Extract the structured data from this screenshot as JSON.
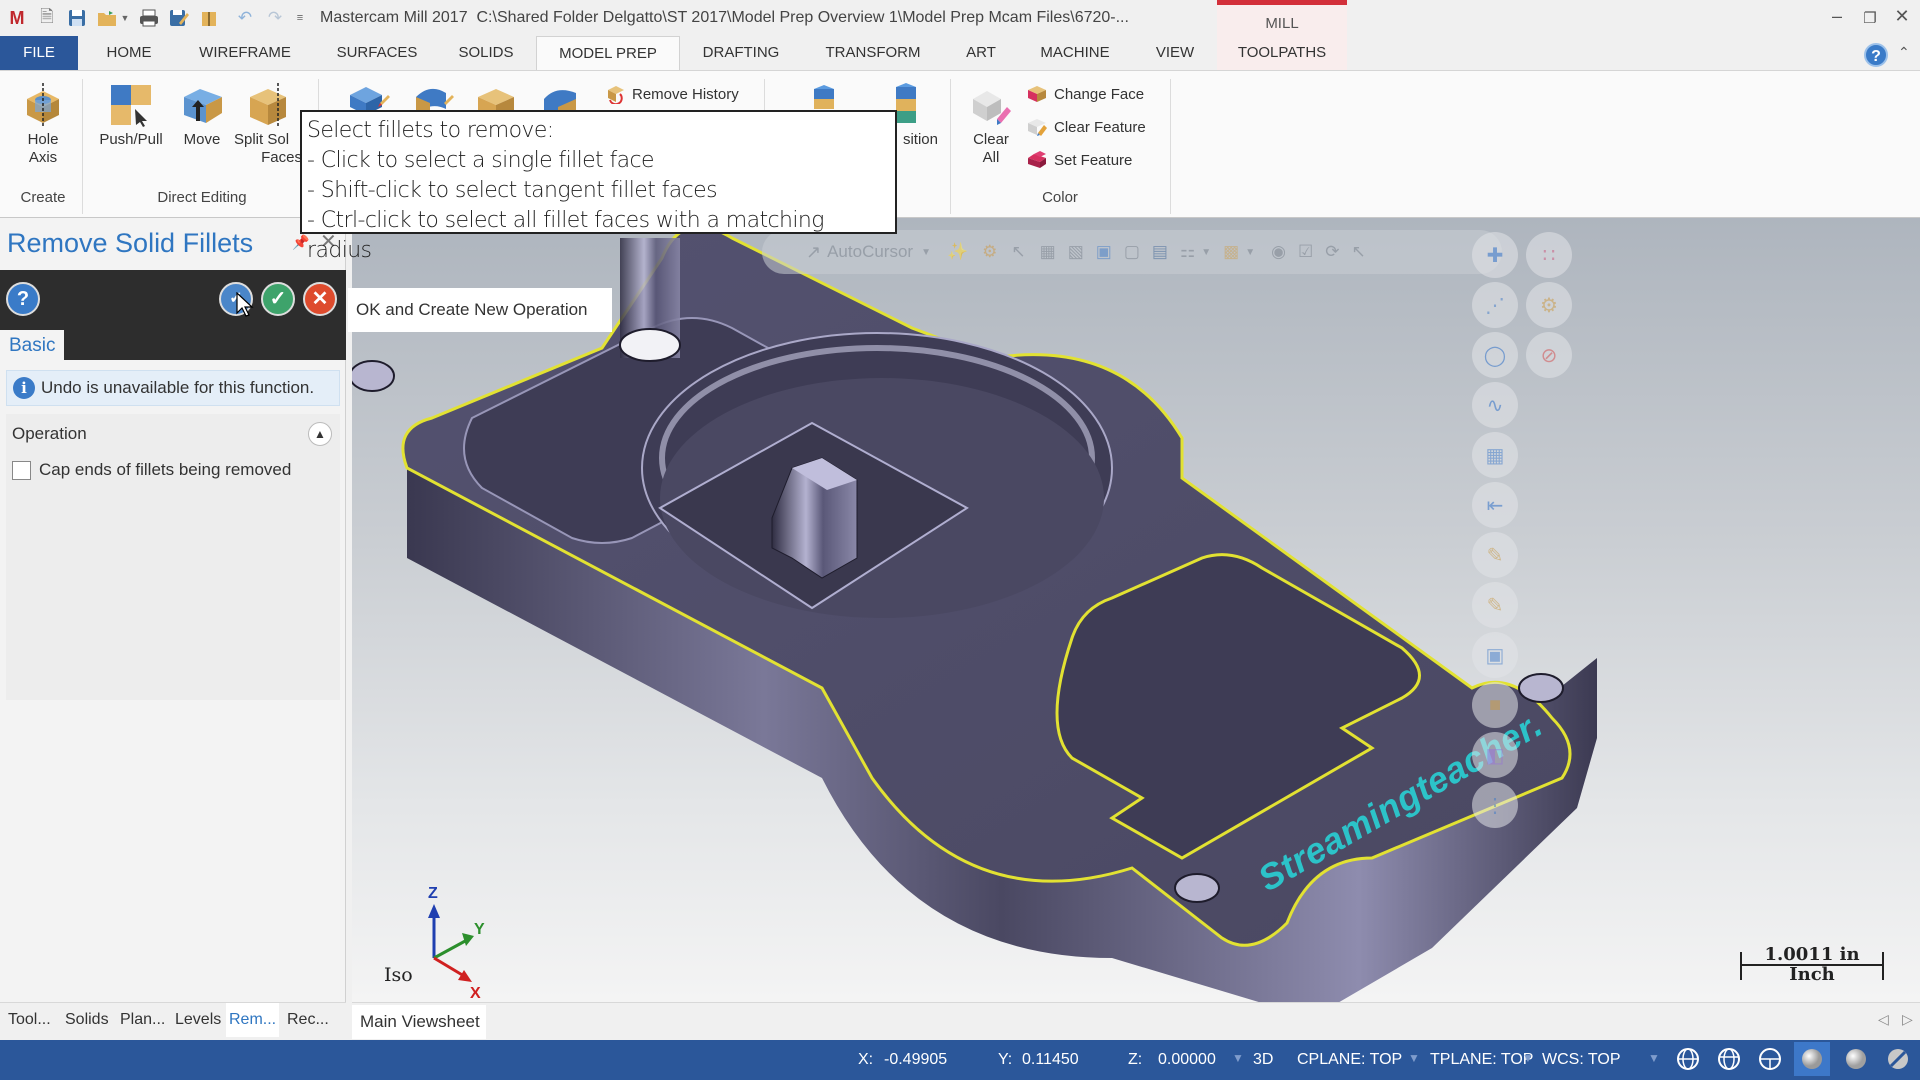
{
  "window": {
    "app_title": "Mastercam Mill 2017",
    "file_path": "C:\\Shared Folder Delgatto\\ST 2017\\Model Prep Overview 1\\Model Prep Mcam Files\\6720-...",
    "context_tab_group": "MILL",
    "context_color": "#d32f3a"
  },
  "tabs": [
    {
      "label": "FILE"
    },
    {
      "label": "HOME"
    },
    {
      "label": "WIREFRAME"
    },
    {
      "label": "SURFACES"
    },
    {
      "label": "SOLIDS"
    },
    {
      "label": "MODEL PREP",
      "active": true
    },
    {
      "label": "DRAFTING"
    },
    {
      "label": "TRANSFORM"
    },
    {
      "label": "ART"
    },
    {
      "label": "MACHINE"
    },
    {
      "label": "VIEW"
    },
    {
      "label": "TOOLPATHS"
    }
  ],
  "ribbon": {
    "create": {
      "group_label": "Create",
      "hole_axis": "Hole\nAxis",
      "hole_axis_l1": "Hole",
      "hole_axis_l2": "Axis"
    },
    "direct_editing": {
      "group_label": "Direct Editing",
      "push_pull": "Push/Pull",
      "move": "Move",
      "split_l1": "Split Sol",
      "split_l2": "Faces",
      "remove_history": "Remove History"
    },
    "layout": {
      "position_partial": "sition"
    },
    "color": {
      "group_label": "Color",
      "clear_all_l1": "Clear",
      "clear_all_l2": "All",
      "change_face": "Change Face",
      "clear_feature": "Clear Feature",
      "set_feature": "Set Feature"
    }
  },
  "hint_tooltip": {
    "lines": [
      "Select fillets to remove:",
      "- Click to select a single fillet face",
      "- Shift-click to select tangent fillet faces",
      "- Ctrl-click to select all fillet faces with a matching radius"
    ]
  },
  "panel": {
    "title": "Remove Solid Fillets",
    "help_glyph": "?",
    "tab_basic": "Basic",
    "info_message": "Undo is unavailable for this function.",
    "operation_label": "Operation",
    "cap_ends_label": "Cap ends of fillets being removed",
    "cap_ends_checked": false,
    "ok_tooltip": "OK and Create New Operation"
  },
  "viewport": {
    "autocursor_label": "AutoCursor",
    "view_name": "Iso",
    "scale_value": "1.0011 in",
    "scale_unit": "Inch",
    "watermark": "Streamingteacher.",
    "axes": {
      "x": "X",
      "y": "Y",
      "z": "Z"
    },
    "model_color": "#4a4860",
    "highlight_color": "#e2e232"
  },
  "bottom_tabs": [
    {
      "label": "Tool..."
    },
    {
      "label": "Solids"
    },
    {
      "label": "Plan..."
    },
    {
      "label": "Levels"
    },
    {
      "label": "Rem...",
      "active": true
    },
    {
      "label": "Rec..."
    }
  ],
  "viewsheet": {
    "tab": "Main Viewsheet"
  },
  "statusbar": {
    "x_label": "X:",
    "x_value": "-0.49905",
    "y_label": "Y:",
    "y_value": "0.11450",
    "z_label": "Z:",
    "z_value": "0.00000",
    "mode": "3D",
    "cplane": "CPLANE: TOP",
    "tplane": "TPLANE: TOP",
    "wcs": "WCS: TOP",
    "bg_color": "#2b579a"
  }
}
